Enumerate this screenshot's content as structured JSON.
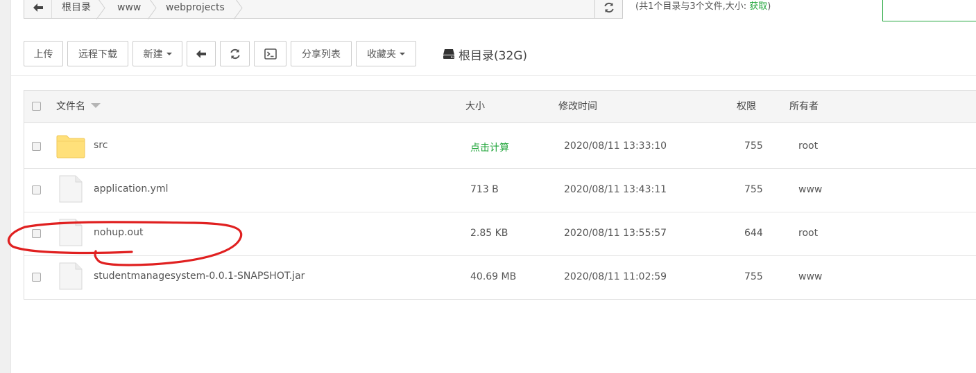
{
  "path": {
    "crumbs": [
      "根目录",
      "www",
      "webprojects"
    ],
    "summary_prefix": "(共1个目录与3个文件,大小: ",
    "summary_link": "获取",
    "summary_suffix": ")"
  },
  "toolbar": {
    "upload": "上传",
    "remote_download": "远程下载",
    "new": "新建",
    "share_list": "分享列表",
    "favorites": "收藏夹",
    "disk": "根目录(32G)"
  },
  "table": {
    "headers": {
      "name": "文件名",
      "size": "大小",
      "modified": "修改时间",
      "permission": "权限",
      "owner": "所有者"
    },
    "rows": [
      {
        "name": "src",
        "type": "folder",
        "size": "点击计算",
        "modified": "2020/08/11 13:33:10",
        "permission": "755",
        "owner": "root"
      },
      {
        "name": "application.yml",
        "type": "file",
        "size": "713 B",
        "modified": "2020/08/11 13:43:11",
        "permission": "755",
        "owner": "www"
      },
      {
        "name": "nohup.out",
        "type": "file",
        "size": "2.85 KB",
        "modified": "2020/08/11 13:55:57",
        "permission": "644",
        "owner": "root"
      },
      {
        "name": "studentmanagesystem-0.0.1-SNAPSHOT.jar",
        "type": "file",
        "size": "40.69 MB",
        "modified": "2020/08/11 11:02:59",
        "permission": "755",
        "owner": "www"
      }
    ]
  },
  "icons": {
    "back": "arrow-left-icon",
    "refresh": "refresh-icon",
    "terminal": "terminal-icon",
    "disk": "hdd-icon",
    "folder": "folder-icon",
    "file": "file-icon"
  },
  "colors": {
    "accent": "#20a53a",
    "folder": "#ffe07a",
    "annotation": "#e02020"
  }
}
